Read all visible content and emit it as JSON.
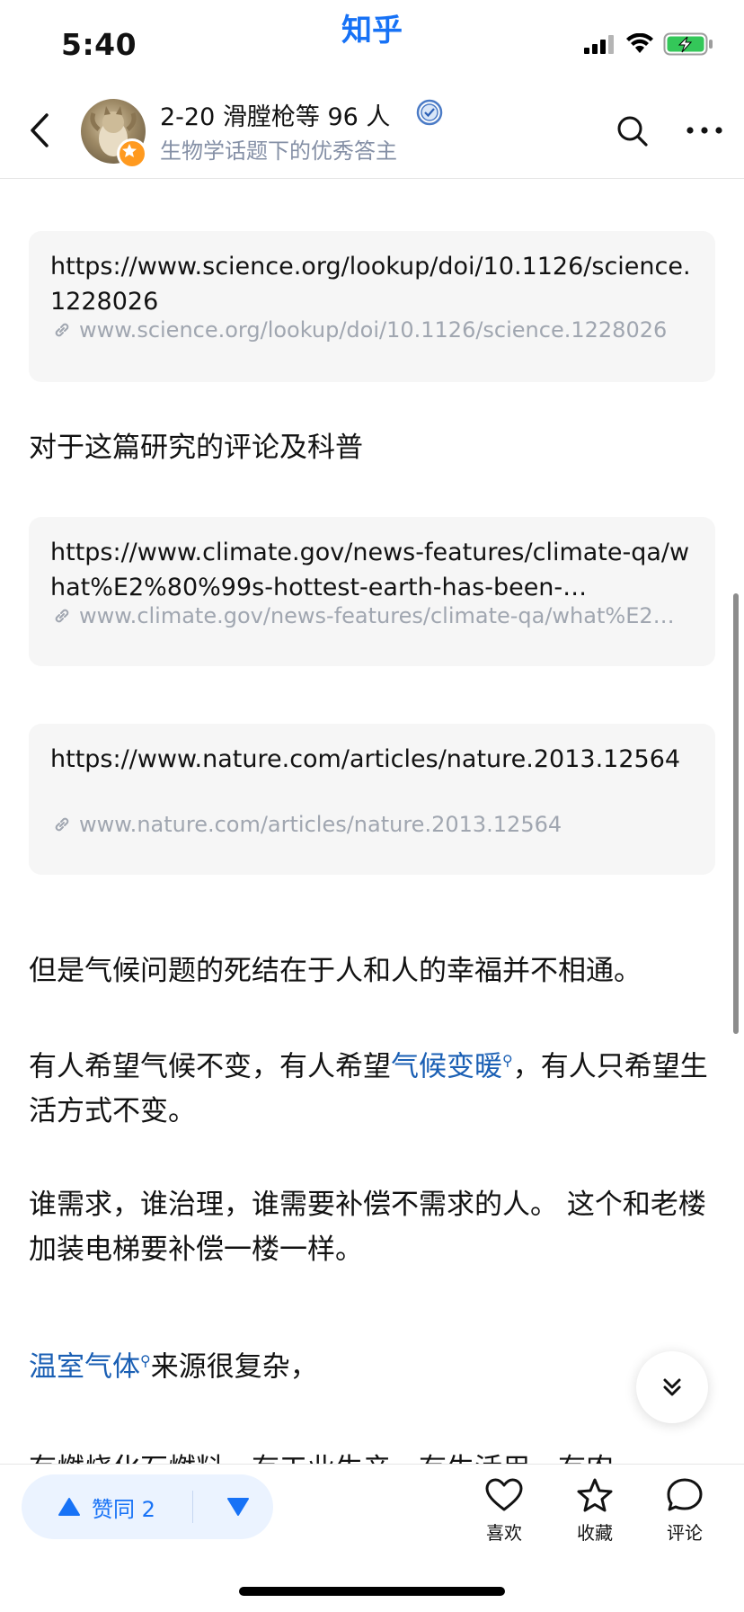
{
  "status_bar": {
    "time": "5:40",
    "app_name": "知乎"
  },
  "header": {
    "title": "2-20 滑膛枪等 96 人",
    "subtitle": "生物学话题下的优秀答主"
  },
  "link_cards": [
    {
      "title": "https://www.science.org/lookup/doi/10.1126/science.1228026",
      "url": "www.science.org/lookup/doi/10.1126/science.1228026"
    },
    {
      "title": "https://www.climate.gov/news-features/climate-qa/what%E2%80%99s-hottest-earth-has-been-…",
      "url": "www.climate.gov/news-features/climate-qa/what%E2…"
    },
    {
      "title": "https://www.nature.com/articles/nature.2013.12564",
      "url": "www.nature.com/articles/nature.2013.12564"
    }
  ],
  "paragraphs": {
    "p1": "对于这篇研究的评论及科普",
    "p2": "但是气候问题的死结在于人和人的幸福并不相通。",
    "p3_a": "有人希望气候不变，有人希望",
    "p3_link": "气候变暖",
    "p3_b": "，有人只希望生活方式不变。",
    "p4": "谁需求，谁治理，谁需要补偿不需求的人。 这个和老楼加装电梯要补偿一楼一样。",
    "p5_link": "温室气体",
    "p5_b": "来源很复杂，",
    "p6_partial": "有燃烧化石燃料，有工业生产，有生活用，有农"
  },
  "bottom_bar": {
    "vote_label": "赞同 2",
    "like_label": "喜欢",
    "collect_label": "收藏",
    "comment_label": "评论"
  },
  "colors": {
    "accent": "#1772f6",
    "link": "#1a5fb4",
    "muted": "#8590a6"
  }
}
